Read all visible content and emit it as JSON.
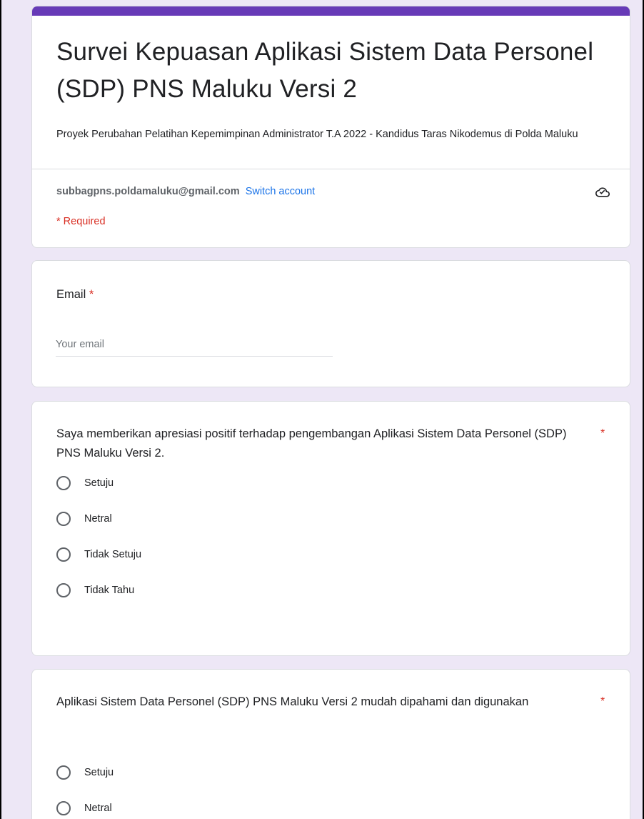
{
  "header": {
    "title": "Survei Kepuasan Aplikasi Sistem Data Personel (SDP) PNS Maluku Versi 2",
    "description": "Proyek Perubahan Pelatihan Kepemimpinan Administrator T.A 2022 - Kandidus Taras Nikodemus di Polda Maluku",
    "account_email": "subbagpns.poldamaluku@gmail.com",
    "switch_account": "Switch account",
    "required_note": "* Required",
    "accent_color": "#673ab7",
    "cloud_icon": "cloud-done-icon"
  },
  "email_question": {
    "label": "Email",
    "required_mark": "*",
    "placeholder": "Your email"
  },
  "questions": [
    {
      "title": "Saya memberikan apresiasi positif terhadap pengembangan Aplikasi Sistem Data Personel (SDP) PNS Maluku Versi 2.",
      "required_mark": "*",
      "options": [
        "Setuju",
        "Netral",
        "Tidak Setuju",
        "Tidak Tahu"
      ]
    },
    {
      "title": "Aplikasi Sistem Data Personel (SDP) PNS Maluku Versi 2 mudah dipahami dan digunakan",
      "required_mark": "*",
      "options": [
        "Setuju",
        "Netral"
      ]
    }
  ]
}
